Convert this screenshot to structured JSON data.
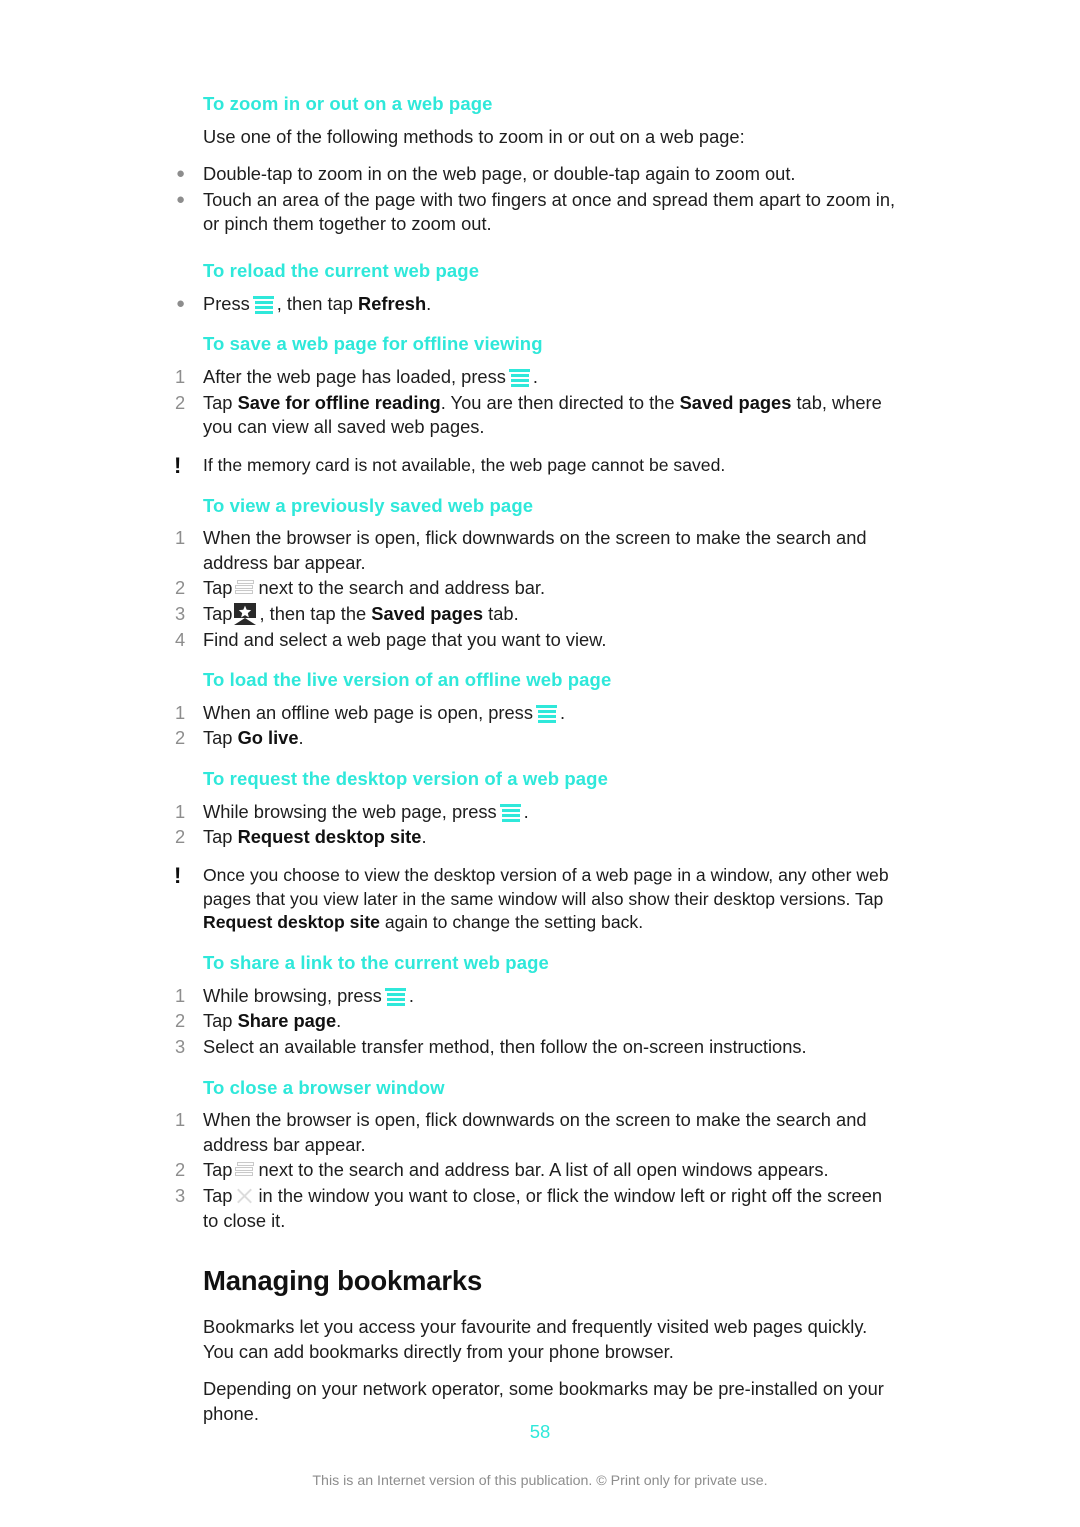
{
  "document": {
    "page_number": "58",
    "footer_note": "This is an Internet version of this publication. © Print only for private use.",
    "accent_color": "#2fe8da",
    "text_color": "#1e1e1e",
    "marker_color": "#8d8d8d"
  },
  "sections": [
    {
      "id": "zoom",
      "heading": "To zoom in or out on a web page",
      "intro": "Use one of the following methods to zoom in or out on a web page:",
      "bullets": [
        "Double-tap to zoom in on the web page, or double-tap again to zoom out.",
        "Touch an area of the page with two fingers at once and spread them apart to zoom in, or pinch them together to zoom out."
      ]
    },
    {
      "id": "reload",
      "heading": "To reload the current web page",
      "bullet_parts": {
        "before": "Press",
        "icon": "menu-icon",
        "after_1": ", then tap ",
        "bold_1": "Refresh",
        "after_2": "."
      }
    },
    {
      "id": "save-offline",
      "heading": "To save a web page for offline viewing",
      "steps": [
        {
          "num": "1",
          "before": "After the web page has loaded, press",
          "icon": "menu-icon",
          "after": "."
        },
        {
          "num": "2",
          "before": "Tap ",
          "bold_1": "Save for offline reading",
          "mid": ". You are then directed to the ",
          "bold_2": "Saved pages",
          "after": " tab, where you can view all saved web pages."
        }
      ],
      "note": "If the memory card is not available, the web page cannot be saved."
    },
    {
      "id": "view-saved",
      "heading": "To view a previously saved web page",
      "steps": [
        {
          "num": "1",
          "text": "When the browser is open, flick downwards on the screen to make the search and address bar appear."
        },
        {
          "num": "2",
          "before": "Tap",
          "icon": "windows-icon",
          "after": "next to the search and address bar."
        },
        {
          "num": "3",
          "before": "Tap",
          "icon": "bookmark-star-icon",
          "mid": ", then tap the ",
          "bold_1": "Saved pages",
          "after": " tab."
        },
        {
          "num": "4",
          "text": "Find and select a web page that you want to view."
        }
      ]
    },
    {
      "id": "go-live",
      "heading": "To load the live version of an offline web page",
      "steps": [
        {
          "num": "1",
          "before": "When an offline web page is open, press",
          "icon": "menu-icon",
          "after": "."
        },
        {
          "num": "2",
          "before": "Tap ",
          "bold_1": "Go live",
          "after": "."
        }
      ]
    },
    {
      "id": "desktop-site",
      "heading": "To request the desktop version of a web page",
      "steps": [
        {
          "num": "1",
          "before": "While browsing the web page, press",
          "icon": "menu-icon",
          "after": "."
        },
        {
          "num": "2",
          "before": "Tap ",
          "bold_1": "Request desktop site",
          "after": "."
        }
      ],
      "note_parts": {
        "before": "Once you choose to view the desktop version of a web page in a window, any other web pages that you view later in the same window will also show their desktop versions. Tap ",
        "bold_1": "Request desktop site",
        "after": " again to change the setting back."
      }
    },
    {
      "id": "share-link",
      "heading": "To share a link to the current web page",
      "steps": [
        {
          "num": "1",
          "before": "While browsing, press",
          "icon": "menu-icon",
          "after": "."
        },
        {
          "num": "2",
          "before": "Tap ",
          "bold_1": "Share page",
          "after": "."
        },
        {
          "num": "3",
          "text": "Select an available transfer method, then follow the on-screen instructions."
        }
      ]
    },
    {
      "id": "close-window",
      "heading": "To close a browser window",
      "steps": [
        {
          "num": "1",
          "text": "When the browser is open, flick downwards on the screen to make the search and address bar appear."
        },
        {
          "num": "2",
          "before": "Tap",
          "icon": "windows-icon",
          "after": "next to the search and address bar. A list of all open windows appears."
        },
        {
          "num": "3",
          "before": "Tap",
          "icon": "close-icon",
          "after": "in the window you want to close, or flick the window left or right off the screen to close it."
        }
      ]
    }
  ],
  "chapter": {
    "title": "Managing bookmarks",
    "paragraphs": [
      "Bookmarks let you access your favourite and frequently visited web pages quickly. You can add bookmarks directly from your phone browser.",
      "Depending on your network operator, some bookmarks may be pre-installed on your phone."
    ]
  }
}
